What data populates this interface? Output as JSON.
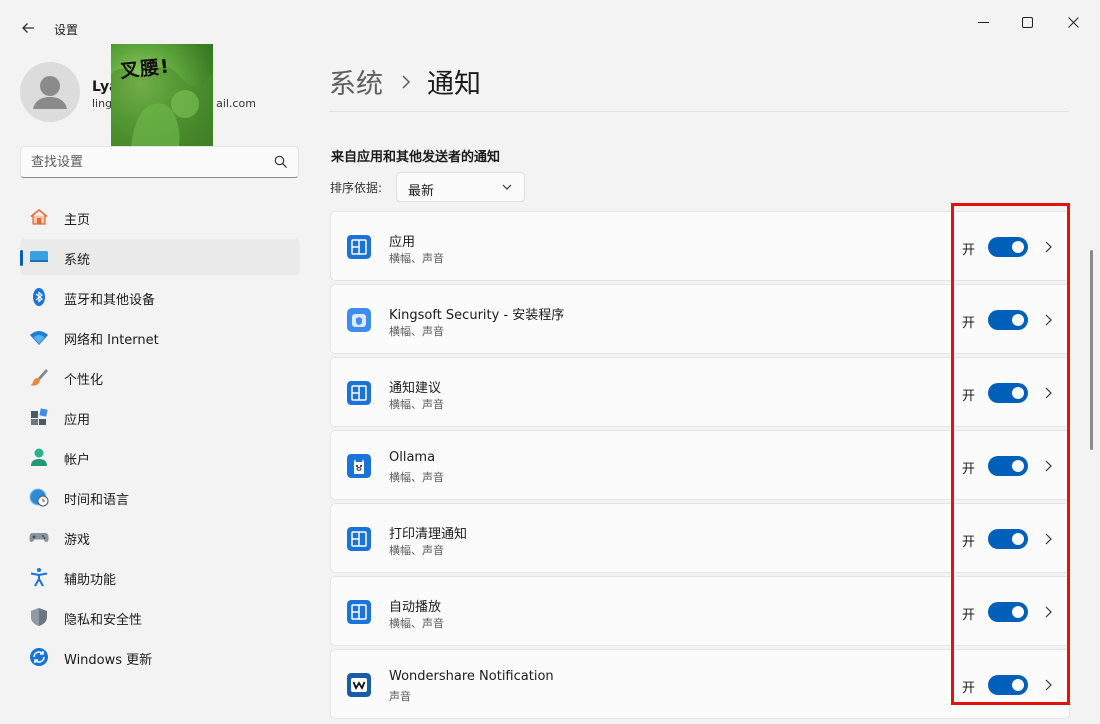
{
  "window": {
    "title": "设置",
    "back_icon": "arrow-left-icon",
    "minimize_icon": "minimize-icon",
    "maximize_icon": "maximize-icon",
    "close_icon": "close-icon"
  },
  "profile": {
    "name": "Lya",
    "email_prefix": "ling",
    "email_suffix": "ail.com",
    "sticker_text": "叉腰!"
  },
  "search": {
    "placeholder": "查找设置",
    "value": ""
  },
  "sidebar": {
    "items": [
      {
        "label": "主页",
        "icon": "home-icon",
        "selected": false
      },
      {
        "label": "系统",
        "icon": "system-display-icon",
        "selected": true
      },
      {
        "label": "蓝牙和其他设备",
        "icon": "bluetooth-icon",
        "selected": false
      },
      {
        "label": "网络和 Internet",
        "icon": "wifi-icon",
        "selected": false
      },
      {
        "label": "个性化",
        "icon": "paintbrush-icon",
        "selected": false
      },
      {
        "label": "应用",
        "icon": "apps-icon",
        "selected": false
      },
      {
        "label": "帐户",
        "icon": "account-icon",
        "selected": false
      },
      {
        "label": "时间和语言",
        "icon": "globe-clock-icon",
        "selected": false
      },
      {
        "label": "游戏",
        "icon": "gamepad-icon",
        "selected": false
      },
      {
        "label": "辅助功能",
        "icon": "accessibility-icon",
        "selected": false
      },
      {
        "label": "隐私和安全性",
        "icon": "shield-icon",
        "selected": false
      },
      {
        "label": "Windows 更新",
        "icon": "update-icon",
        "selected": false
      }
    ]
  },
  "main": {
    "breadcrumb_parent": "系统",
    "breadcrumb_current": "通知",
    "section_title": "来自应用和其他发送者的通知",
    "sort_label": "排序依据:",
    "sort_value": "最新",
    "apps": [
      {
        "name": "应用",
        "subtitle": "横幅、声音",
        "toggle_label": "开",
        "on": true,
        "icon": "app-tile-icon"
      },
      {
        "name": "Kingsoft Security - 安装程序",
        "subtitle": "横幅、声音",
        "toggle_label": "开",
        "on": true,
        "icon": "kingsoft-security-icon"
      },
      {
        "name": "通知建议",
        "subtitle": "横幅、声音",
        "toggle_label": "开",
        "on": true,
        "icon": "app-tile-icon"
      },
      {
        "name": "Ollama",
        "subtitle": "横幅、声音",
        "toggle_label": "开",
        "on": true,
        "icon": "ollama-icon"
      },
      {
        "name": "打印清理通知",
        "subtitle": "横幅、声音",
        "toggle_label": "开",
        "on": true,
        "icon": "app-tile-icon"
      },
      {
        "name": "自动播放",
        "subtitle": "横幅、声音",
        "toggle_label": "开",
        "on": true,
        "icon": "app-tile-icon"
      },
      {
        "name": "Wondershare Notification",
        "subtitle": "声音",
        "toggle_label": "开",
        "on": true,
        "icon": "wondershare-icon"
      }
    ]
  },
  "colors": {
    "accent": "#005fb8",
    "highlight_box": "#e3120b",
    "background": "#f3f3f3",
    "card": "#fbfbfb"
  }
}
